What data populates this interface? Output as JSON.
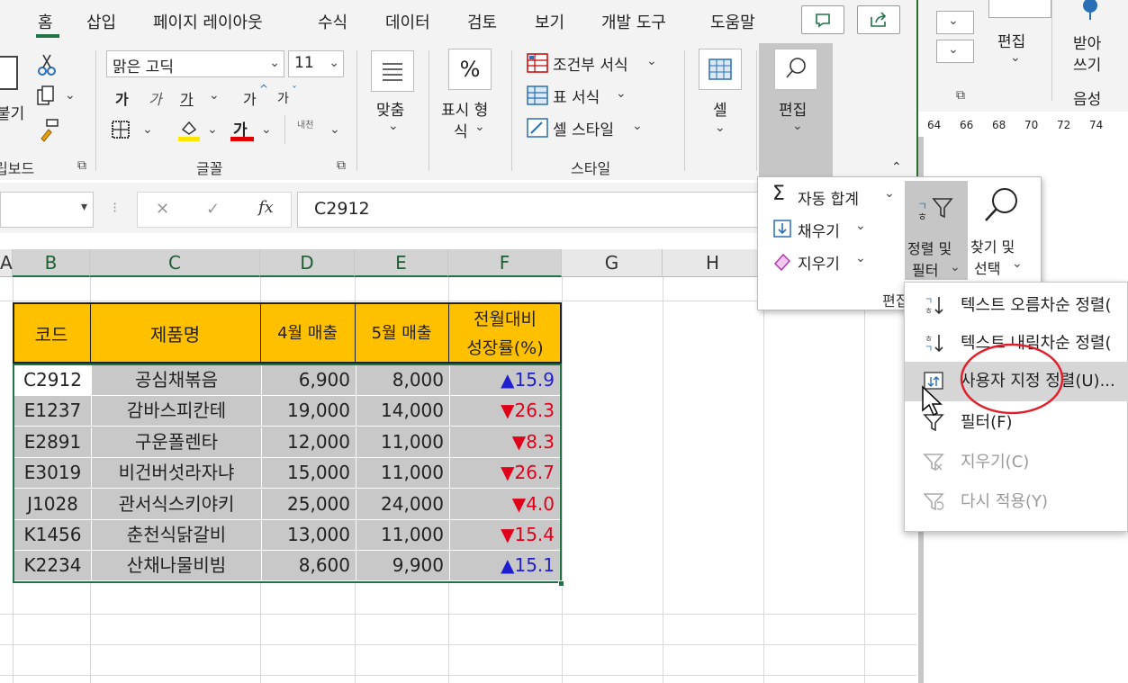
{
  "ribbon": {
    "tabs": [
      "홈",
      "삽입",
      "페이지 레이아웃",
      "수식",
      "데이터",
      "검토",
      "보기",
      "개발 도구",
      "도움말"
    ],
    "clipboard_fragment": "붙기",
    "clipboard_group": "립보드",
    "font_name": "맑은 고딕",
    "font_size": "11",
    "bold_glyph": "가",
    "italic_glyph": "가",
    "underline_glyph": "가",
    "grow_glyph": "가",
    "shrink_glyph": "가",
    "fontcolor_glyph": "가",
    "phonetic_glyph": "내천",
    "font_group": "글꼴",
    "align_label": "맞춤",
    "number_label_1": "표시 형",
    "number_label_2": "식",
    "percent_glyph": "%",
    "cond_format": "조건부 서식",
    "table_format": "표 서식",
    "cell_style": "셀 스타일",
    "style_group": "스타일",
    "cells_label": "셀",
    "edit_label": "편집",
    "colors": {
      "accent": "#217346",
      "font_color_bar": "#e00000",
      "fill_color_bar": "#ffe600"
    }
  },
  "right_pane": {
    "edit": "편집",
    "receive_1": "받아",
    "receive_2": "쓰기",
    "voice": "음성",
    "ruler": [
      "64",
      "66",
      "68",
      "70",
      "72",
      "74"
    ]
  },
  "formula_bar": {
    "fx": "fx",
    "value": "C2912",
    "cancel": "✕",
    "enter": "✓"
  },
  "columns": [
    "A",
    "B",
    "C",
    "D",
    "E",
    "F",
    "G",
    "H"
  ],
  "table": {
    "headers": [
      "코드",
      "제품명",
      "4월 매출",
      "5월 매출",
      "전월대비",
      "성장률(%)"
    ],
    "rows": [
      {
        "code": "C2912",
        "name": "공심채볶음",
        "apr": "6,900",
        "may": "8,000",
        "arrow": "▲",
        "growth": "15.9",
        "up": true
      },
      {
        "code": "E1237",
        "name": "감바스피칸테",
        "apr": "19,000",
        "may": "14,000",
        "arrow": "▼",
        "growth": "26.3",
        "up": false
      },
      {
        "code": "E2891",
        "name": "구운폴렌타",
        "apr": "12,000",
        "may": "11,000",
        "arrow": "▼",
        "growth": "8.3",
        "up": false
      },
      {
        "code": "E3019",
        "name": "비건버섯라자냐",
        "apr": "15,000",
        "may": "11,000",
        "arrow": "▼",
        "growth": "26.7",
        "up": false
      },
      {
        "code": "J1028",
        "name": "관서식스키야키",
        "apr": "25,000",
        "may": "24,000",
        "arrow": "▼",
        "growth": "4.0",
        "up": false
      },
      {
        "code": "K1456",
        "name": "춘천식닭갈비",
        "apr": "13,000",
        "may": "11,000",
        "arrow": "▼",
        "growth": "15.4",
        "up": false
      },
      {
        "code": "K2234",
        "name": "산채나물비빔",
        "apr": "8,600",
        "may": "9,900",
        "arrow": "▲",
        "growth": "15.1",
        "up": true
      }
    ],
    "colors": {
      "header_fill": "#ffc000",
      "body_fill": "#c8c8c8",
      "up": "#1f1fd0",
      "down": "#e0001a"
    }
  },
  "edit_panel": {
    "autosum": "자동 합계",
    "fill": "채우기",
    "clear": "지우기",
    "sort1": "정렬 및",
    "sort2": "필터",
    "find1": "찾기 및",
    "find2": "선택",
    "group": "편집"
  },
  "sort_menu": {
    "items": [
      {
        "label": "텍스트 오름차순 정렬(",
        "enabled": true,
        "icon": "sort-asc-icon"
      },
      {
        "label": "텍스트 내림차순 정렬(",
        "enabled": true,
        "icon": "sort-desc-icon"
      },
      {
        "label": "사용자 지정 정렬(U)...",
        "enabled": true,
        "hover": true,
        "icon": "custom-sort-icon"
      },
      {
        "label": "필터(F)",
        "enabled": true,
        "icon": "filter-icon"
      },
      {
        "label": "지우기(C)",
        "enabled": false,
        "icon": "filter-clear-icon"
      },
      {
        "label": "다시 적용(Y)",
        "enabled": false,
        "icon": "reapply-icon"
      }
    ]
  }
}
